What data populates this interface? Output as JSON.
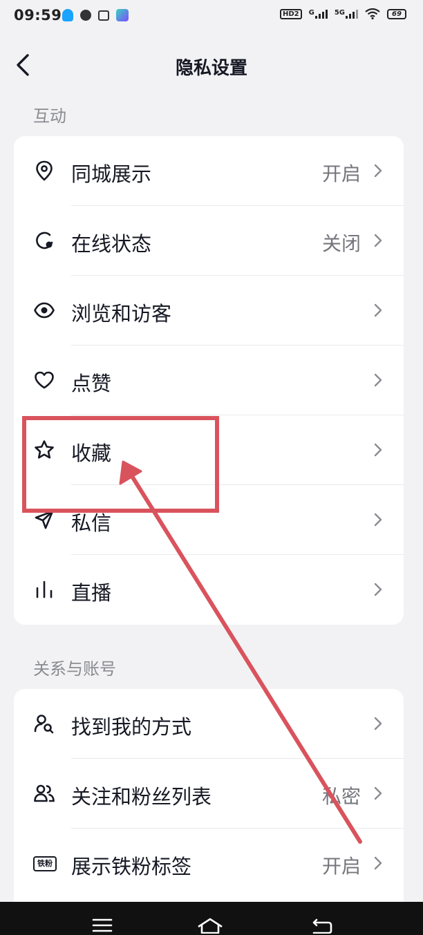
{
  "status_bar": {
    "time": "09:59",
    "network_hd": "HD2",
    "network_g": "G",
    "network_5g": "5G",
    "battery": "69"
  },
  "header": {
    "title": "隐私设置",
    "back_icon": "chevron-left-icon"
  },
  "sections": {
    "interaction": {
      "title": "互动",
      "items": [
        {
          "label": "同城展示",
          "value": "开启",
          "icon": "location-pin-icon"
        },
        {
          "label": "在线状态",
          "value": "关闭",
          "icon": "online-status-icon"
        },
        {
          "label": "浏览和访客",
          "value": "",
          "icon": "eye-icon"
        },
        {
          "label": "点赞",
          "value": "",
          "icon": "heart-icon"
        },
        {
          "label": "收藏",
          "value": "",
          "icon": "star-icon"
        },
        {
          "label": "私信",
          "value": "",
          "icon": "paper-plane-icon"
        },
        {
          "label": "直播",
          "value": "",
          "icon": "bar-chart-icon"
        }
      ]
    },
    "relations": {
      "title": "关系与账号",
      "items": [
        {
          "label": "找到我的方式",
          "value": "",
          "icon": "user-search-icon"
        },
        {
          "label": "关注和粉丝列表",
          "value": "私密",
          "icon": "users-icon"
        },
        {
          "label": "展示铁粉标签",
          "value": "开启",
          "icon": "fan-badge-icon"
        }
      ]
    }
  },
  "fan_badge_text": "铁粉",
  "annotation": {
    "color": "#d9535d",
    "highlight_target": "收藏"
  },
  "colors": {
    "background": "#f2f2f4",
    "card": "#ffffff",
    "text_primary": "#161823",
    "text_secondary": "#75767c",
    "section_title": "#8a8b91"
  }
}
